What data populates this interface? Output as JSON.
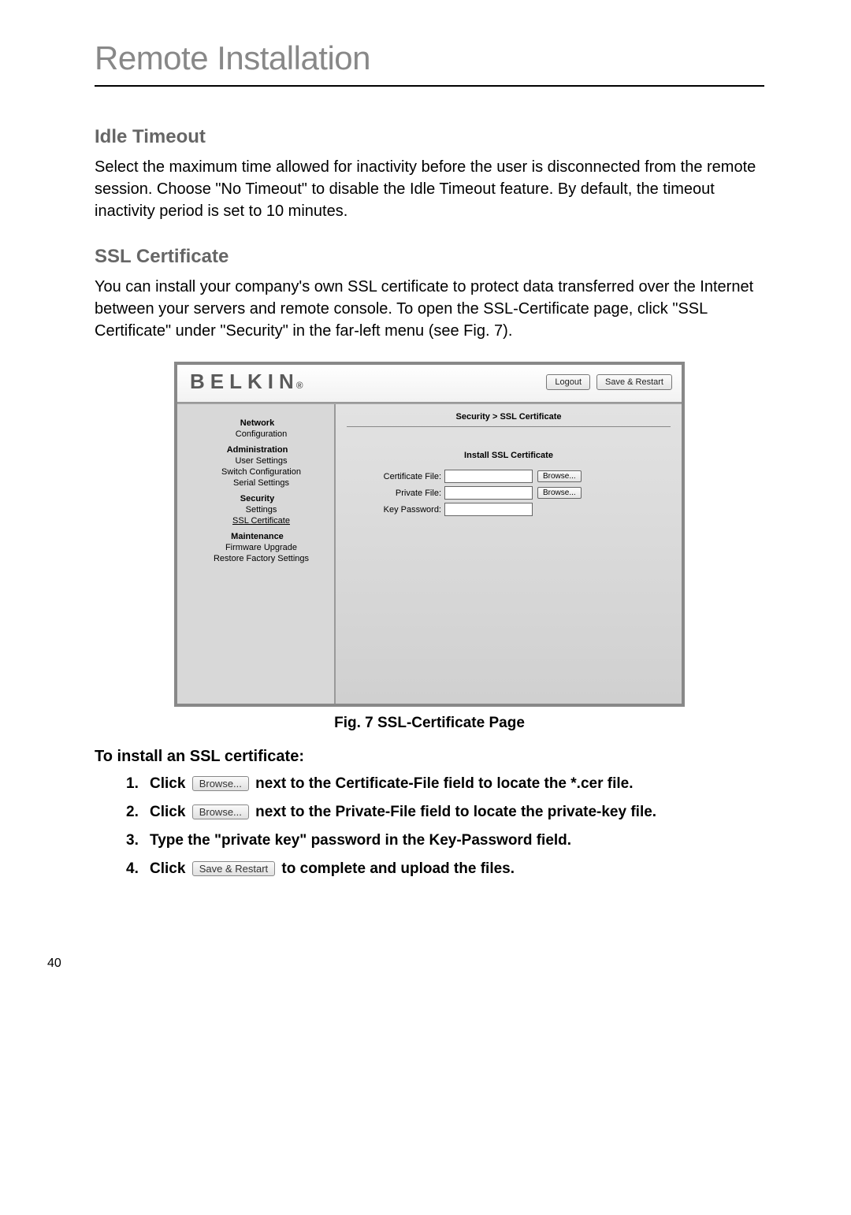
{
  "page": {
    "chapter_title": "Remote Installation",
    "page_number": "40"
  },
  "sections": {
    "idle": {
      "heading": "Idle Timeout",
      "body": "Select the maximum time allowed for inactivity before the user is disconnected from the remote session. Choose \"No Timeout\" to disable the Idle Timeout feature. By default, the timeout inactivity period is set to 10 minutes."
    },
    "ssl": {
      "heading": "SSL Certificate",
      "body": "You can install your company's own SSL certificate to protect data transferred over the Internet between your servers and remote console. To open the SSL-Certificate page, click \"SSL Certificate\" under \"Security\" in the far-left menu (see Fig. 7)."
    }
  },
  "figure": {
    "caption": "Fig. 7 SSL-Certificate Page",
    "app": {
      "brand": "BELKIN",
      "brand_suffix": "®",
      "logout_label": "Logout",
      "save_restart_label": "Save & Restart",
      "breadcrumb": "Security > SSL Certificate",
      "panel_title": "Install SSL Certificate",
      "sidebar": {
        "g1": "Network",
        "g1_1": "Configuration",
        "g2": "Administration",
        "g2_1": "User Settings",
        "g2_2": "Switch Configuration",
        "g2_3": "Serial Settings",
        "g3": "Security",
        "g3_1": "Settings",
        "g3_2": "SSL Certificate",
        "g4": "Maintenance",
        "g4_1": "Firmware Upgrade",
        "g4_2": "Restore Factory Settings"
      },
      "form": {
        "cert_label": "Certificate File:",
        "priv_label": "Private File:",
        "key_label": "Key Password:",
        "browse_label": "Browse..."
      }
    }
  },
  "install": {
    "heading": "To install an SSL certificate:",
    "s1_num": "1.",
    "s1_a": "Click ",
    "s1_btn": "Browse...",
    "s1_b": " next to the Certificate-File field to locate the *.cer file.",
    "s2_num": "2.",
    "s2_a": "Click ",
    "s2_btn": "Browse...",
    "s2_b": " next to the Private-File field to locate the private-key file.",
    "s3_num": "3.",
    "s3_text": "Type the \"private key\" password in the Key-Password field.",
    "s4_num": "4.",
    "s4_a": "Click ",
    "s4_btn": "Save & Restart",
    "s4_b": " to complete and upload the files."
  }
}
